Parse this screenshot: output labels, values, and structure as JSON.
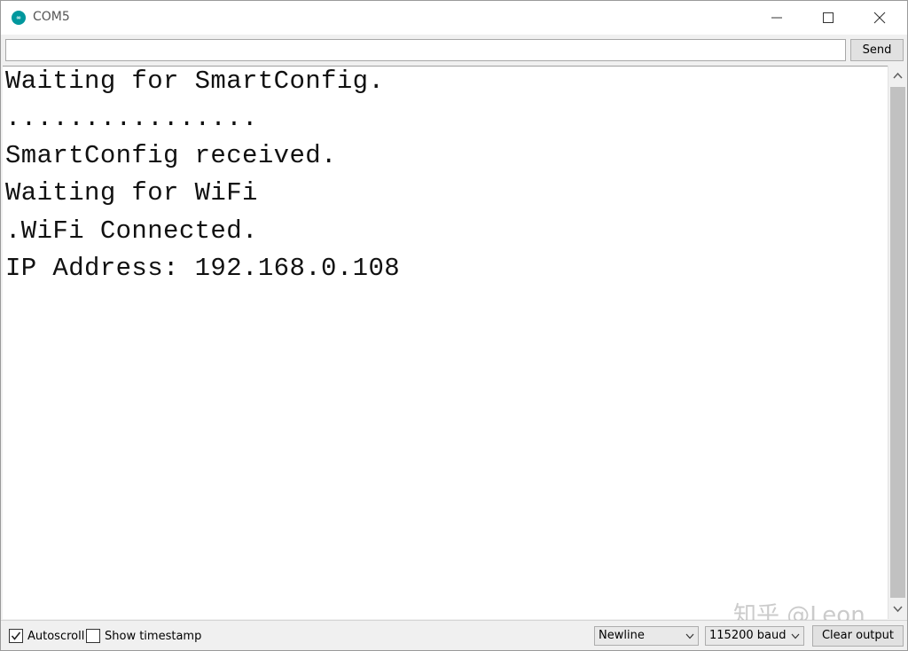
{
  "window": {
    "title": "COM5",
    "icon": "arduino-icon",
    "icon_text": "∞"
  },
  "send_row": {
    "input_value": "",
    "send_label": "Send"
  },
  "output": {
    "lines": [
      "Waiting for SmartConfig.",
      "................",
      "SmartConfig received.",
      "Waiting for WiFi",
      ".WiFi Connected.",
      "IP Address: 192.168.0.108"
    ]
  },
  "watermark": "知乎 @Leon",
  "bottom_bar": {
    "autoscroll_label": "Autoscroll",
    "autoscroll_checked": true,
    "timestamp_label": "Show timestamp",
    "timestamp_checked": false,
    "line_ending": "Newline",
    "baud_rate": "115200 baud",
    "clear_label": "Clear output"
  },
  "colors": {
    "accent": "#00979d",
    "scroll_thumb": "#c1c1c1"
  }
}
